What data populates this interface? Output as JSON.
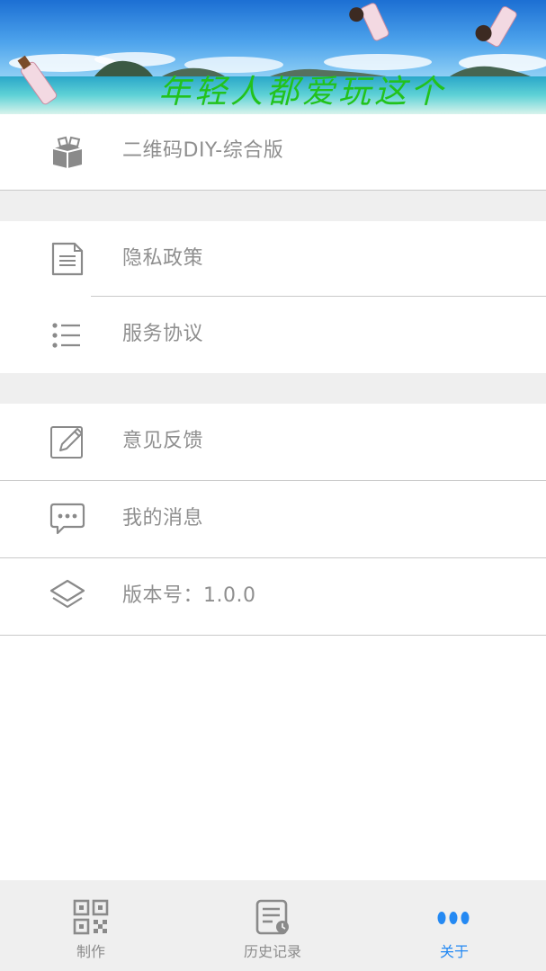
{
  "banner": {
    "slogan": "年轻人都爱玩这个",
    "slogan_color": "#22c21c"
  },
  "menu": {
    "app_name": {
      "label": "二维码DIY-综合版",
      "icon": "box-icon"
    },
    "privacy": {
      "label": "隐私政策",
      "icon": "document-icon"
    },
    "terms": {
      "label": "服务协议",
      "icon": "list-icon"
    },
    "feedback": {
      "label": "意见反馈",
      "icon": "edit-icon"
    },
    "messages": {
      "label": "我的消息",
      "icon": "chat-bubble-icon"
    },
    "version": {
      "label": "版本号：1.0.0",
      "icon": "layers-icon"
    }
  },
  "bottom_nav": {
    "items": [
      {
        "label": "制作",
        "icon": "qr-code-icon",
        "active": false
      },
      {
        "label": "历史记录",
        "icon": "history-icon",
        "active": false
      },
      {
        "label": "关于",
        "icon": "more-dots-icon",
        "active": true
      }
    ],
    "active_color": "#2489f3",
    "inactive_color": "#8d8d8d"
  }
}
